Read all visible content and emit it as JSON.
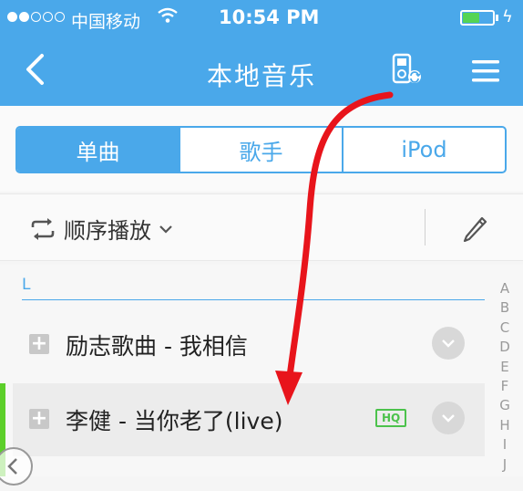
{
  "status_bar": {
    "carrier": "中国移动",
    "time": "10:54 PM",
    "battery_level": 0.55,
    "signal_dots_filled": 2,
    "signal_dots_total": 5
  },
  "nav": {
    "title": "本地音乐",
    "back_icon": "chevron-left-icon",
    "ipod_icon": "ipod-sync-icon",
    "menu_icon": "menu-icon"
  },
  "tabs": [
    {
      "label": "单曲",
      "active": true
    },
    {
      "label": "歌手",
      "active": false
    },
    {
      "label": "iPod",
      "active": false
    }
  ],
  "play_mode": {
    "label": "顺序播放",
    "icon": "repeat-icon"
  },
  "list": {
    "section": "L",
    "items": [
      {
        "title": "励志歌曲 - 我相信",
        "hq": ""
      },
      {
        "title": "李健 - 当你老了(live)",
        "hq": "HQ"
      }
    ]
  },
  "index_letters": [
    "A",
    "B",
    "C",
    "D",
    "E",
    "F",
    "G",
    "H",
    "I",
    "J"
  ],
  "colors": {
    "accent": "#4aa8ea",
    "hq": "#4cc24c",
    "annotation_arrow": "#e8141b"
  }
}
